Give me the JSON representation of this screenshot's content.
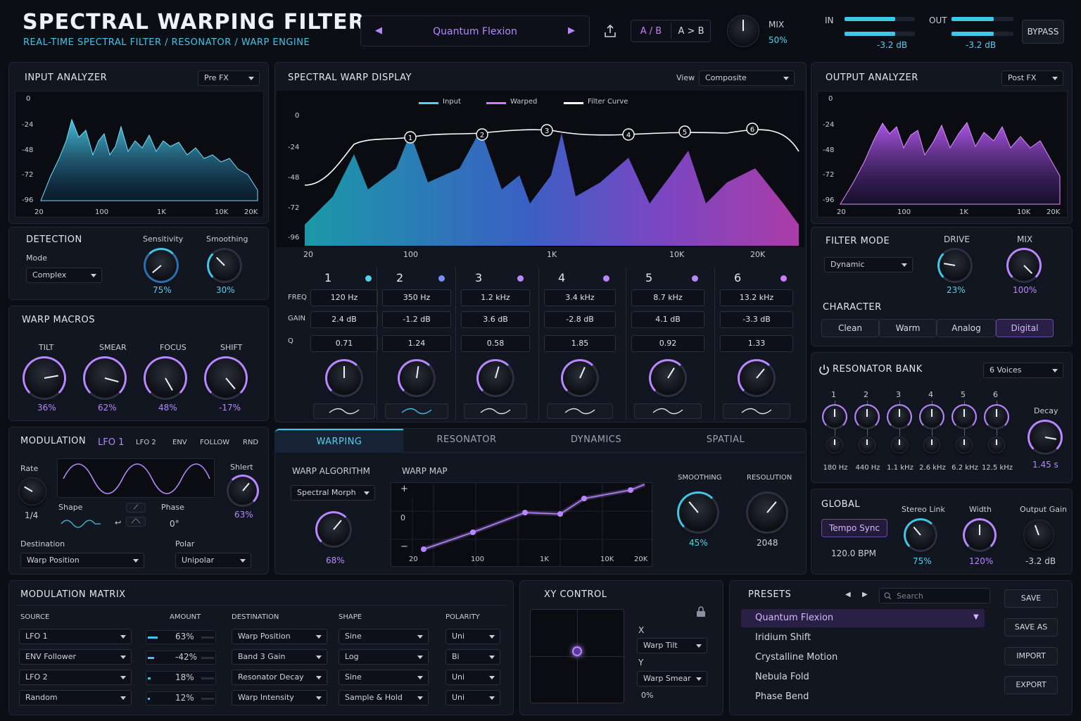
{
  "header": {
    "title": "SPECTRAL WARPING FILTER",
    "subtitle": "REAL-TIME SPECTRAL FILTER / RESONATOR / WARP ENGINE",
    "preset": "Quantum Flexion",
    "ab": "A / B",
    "atob": "A > B",
    "mix_label": "MIX",
    "mix_value": "50%",
    "in_label": "IN",
    "out_label": "OUT",
    "in_db": "-3.2 dB",
    "out_db": "-3.2 dB",
    "bypass": "BYPASS",
    "in_level": 0.72,
    "out_level": 0.68
  },
  "input_analyzer": {
    "title": "INPUT ANALYZER",
    "mode": "Pre FX",
    "y_ticks": [
      "0",
      "-24",
      "-48",
      "-72",
      "-96"
    ],
    "x_ticks": [
      "20",
      "100",
      "1K",
      "10K",
      "20K"
    ]
  },
  "detection": {
    "title": "DETECTION",
    "mode_label": "Mode",
    "mode": "Complex",
    "sensitivity_label": "Sensitivity",
    "sensitivity": "75%",
    "smoothing_label": "Smoothing",
    "smoothing": "30%"
  },
  "warp_macros": {
    "title": "WARP MACROS",
    "items": [
      {
        "label": "TILT",
        "value": "36%"
      },
      {
        "label": "SMEAR",
        "value": "62%"
      },
      {
        "label": "FOCUS",
        "value": "48%"
      },
      {
        "label": "SHIFT",
        "value": "-17%"
      }
    ]
  },
  "modulation": {
    "title": "MODULATION",
    "tabs": [
      "LFO 1",
      "LFO 2",
      "ENV",
      "FOLLOW",
      "RND"
    ],
    "rate_label": "Rate",
    "rate": "1/4",
    "shape_label": "Shape",
    "phase_label": "Phase",
    "phase": "0°",
    "shift_label": "Shlert",
    "shift": "63%",
    "dest_label": "Destination",
    "dest": "Warp Position",
    "polar_label": "Polar",
    "polar": "Unipolar"
  },
  "spectral": {
    "title": "SPECTRAL WARP DISPLAY",
    "view_label": "View",
    "view": "Composite",
    "legend": [
      "Input",
      "Warped",
      "Filter Curve"
    ],
    "y_ticks": [
      "0",
      "-24",
      "-48",
      "-72",
      "-96"
    ],
    "x_ticks": [
      "20",
      "100",
      "1K",
      "10K",
      "20K"
    ],
    "row_labels": [
      "FREQ",
      "GAIN",
      "Q"
    ],
    "bands": [
      {
        "n": "1",
        "freq": "120 Hz",
        "gain": "2.4 dB",
        "q": "0.71",
        "color": "#4fd3ef"
      },
      {
        "n": "2",
        "freq": "350 Hz",
        "gain": "-1.2 dB",
        "q": "1.24",
        "color": "#7a8cff"
      },
      {
        "n": "3",
        "freq": "1.2 kHz",
        "gain": "3.6 dB",
        "q": "0.58",
        "color": "#b886ff"
      },
      {
        "n": "4",
        "freq": "3.4 kHz",
        "gain": "-2.8 dB",
        "q": "1.85",
        "color": "#b886ff"
      },
      {
        "n": "5",
        "freq": "8.7 kHz",
        "gain": "4.1 dB",
        "q": "0.92",
        "color": "#b886ff"
      },
      {
        "n": "6",
        "freq": "13.2 kHz",
        "gain": "-3.3 dB",
        "q": "1.33",
        "color": "#d07aff"
      }
    ]
  },
  "tabs": [
    "WARPING",
    "RESONATOR",
    "DYNAMICS",
    "SPATIAL"
  ],
  "warping": {
    "algo_label": "WARP ALGORITHM",
    "algo": "Spectral Morph",
    "algo_value": "68%",
    "map_label": "WARP MAP",
    "map_y": [
      "+",
      "0",
      "−"
    ],
    "map_x": [
      "20",
      "100",
      "1K",
      "10K",
      "20K"
    ],
    "smoothing_label": "SMOOTHING",
    "smoothing": "45%",
    "resolution_label": "RESOLUTION",
    "resolution": "2048"
  },
  "output_analyzer": {
    "title": "OUTPUT ANALYZER",
    "mode": "Post FX",
    "y_ticks": [
      "0",
      "-24",
      "-48",
      "-72",
      "-96"
    ],
    "x_ticks": [
      "20",
      "100",
      "1K",
      "10K",
      "20K"
    ]
  },
  "filter_mode": {
    "title": "FILTER MODE",
    "mode": "Dynamic",
    "drive_label": "DRIVE",
    "drive": "23%",
    "mix_label": "MIX",
    "mix": "100%",
    "character_label": "CHARACTER",
    "characters": [
      "Clean",
      "Warm",
      "Analog",
      "Digital"
    ]
  },
  "resonator": {
    "title": "RESONATOR BANK",
    "voices": "6 Voices",
    "nums": [
      "1",
      "2",
      "3",
      "4",
      "5",
      "6"
    ],
    "freqs": [
      "180 Hz",
      "440 Hz",
      "1.1 kHz",
      "2.6 kHz",
      "6.2 kHz",
      "12.5 kHz"
    ],
    "decay_label": "Decay",
    "decay": "1.45 s"
  },
  "global": {
    "title": "GLOBAL",
    "tempo_sync": "Tempo Sync",
    "bpm": "120.0 BPM",
    "stereo_label": "Stereo Link",
    "stereo": "75%",
    "width_label": "Width",
    "width": "120%",
    "gain_label": "Output Gain",
    "gain": "-3.2 dB"
  },
  "matrix": {
    "title": "MODULATION MATRIX",
    "headers": [
      "SOURCE",
      "AMOUNT",
      "DESTINATION",
      "SHAPE",
      "POLARITY"
    ],
    "rows": [
      {
        "source": "LFO 1",
        "amount": "63%",
        "dest": "Warp Position",
        "shape": "Sine",
        "pol": "Uni",
        "lvl": 0.63
      },
      {
        "source": "ENV Follower",
        "amount": "-42%",
        "dest": "Band 3 Gain",
        "shape": "Log",
        "pol": "Bi",
        "lvl": 0.42
      },
      {
        "source": "LFO 2",
        "amount": "18%",
        "dest": "Resonator Decay",
        "shape": "Sine",
        "pol": "Uni",
        "lvl": 0.18
      },
      {
        "source": "Random",
        "amount": "12%",
        "dest": "Warp Intensity",
        "shape": "Sample & Hold",
        "pol": "Uni",
        "lvl": 0.12
      }
    ]
  },
  "xy": {
    "title": "XY CONTROL",
    "x_label": "X",
    "x": "Warp Tilt",
    "y_label": "Y",
    "y": "Warp Smear",
    "value": "0%"
  },
  "presets": {
    "title": "PRESETS",
    "search": "Search",
    "items": [
      "Quantum Flexion",
      "Iridium Shift",
      "Crystalline Motion",
      "Nebula Fold",
      "Phase Bend"
    ],
    "buttons": [
      "SAVE",
      "SAVE AS",
      "IMPORT",
      "EXPORT"
    ]
  }
}
